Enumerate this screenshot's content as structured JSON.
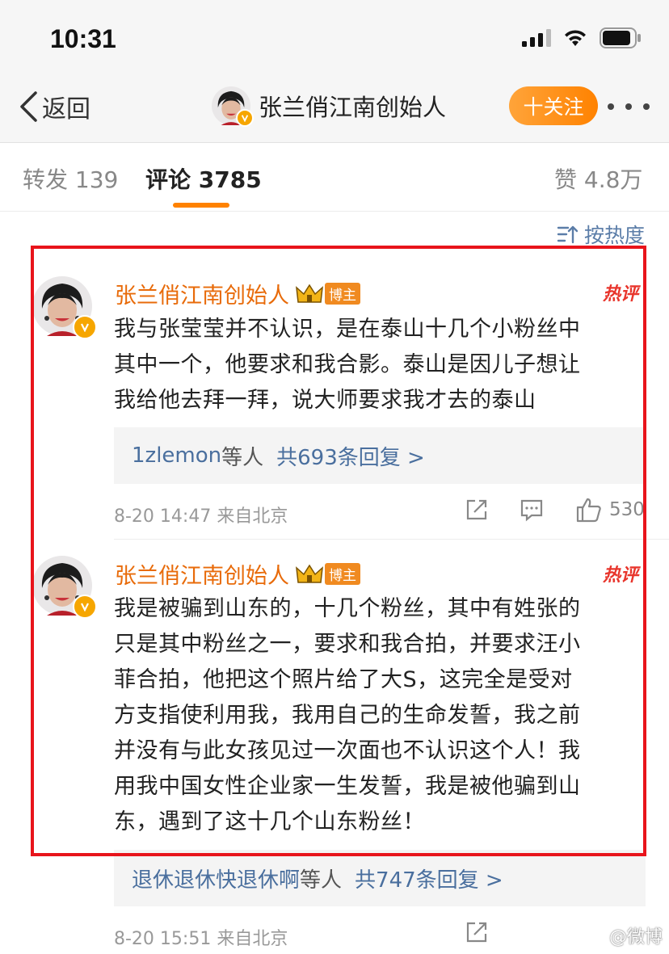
{
  "status_bar": {
    "time": "10:31"
  },
  "nav": {
    "back_label": "返回",
    "title": "张兰俏江南创始人",
    "follow_label": "十关注"
  },
  "tabs": [
    {
      "label": "转发 139",
      "active": false
    },
    {
      "label": "评论 3785",
      "active": true
    },
    {
      "label": "赞 4.8万",
      "active": false
    }
  ],
  "sort_label": "按热度",
  "comments": [
    {
      "author": "张兰俏江南创始人",
      "role_tag": "博主",
      "hot_tag": "热评",
      "lines": [
        "我与张莹莹并不认识，是在泰山十几个小粉丝中",
        "其中一个，他要求和我合影。泰山是因儿子想让",
        "我给他去拜一拜，说大师要求我才去的泰山"
      ],
      "reply_users": "1zlemon",
      "reply_etc": " 等人",
      "reply_count": "共693条回复 >",
      "meta": "8-20 14:47 来自北京",
      "likes": "530"
    },
    {
      "author": "张兰俏江南创始人",
      "role_tag": "博主",
      "hot_tag": "热评",
      "lines": [
        "我是被骗到山东的，十几个粉丝，其中有姓张的",
        "只是其中粉丝之一，要求和我合拍，并要求汪小",
        "菲合拍，他把这个照片给了大S，这完全是受对",
        "方支指使利用我，我用自己的生命发誓，我之前",
        "并没有与此女孩见过一次面也不认识这个人！我",
        "用我中国女性企业家一生发誓，我是被他骗到山",
        "东，遇到了这十几个山东粉丝！"
      ],
      "reply_users": "退休退休快退休啊",
      "reply_etc": "等人",
      "reply_count": "共747条回复 >",
      "meta": "8-20 15:51 来自北京"
    }
  ],
  "watermark": "@微博",
  "colors": {
    "accent": "#ff8200",
    "name": "#e86b0a",
    "link": "#4a6f9e",
    "highlight": "#e8141b"
  }
}
